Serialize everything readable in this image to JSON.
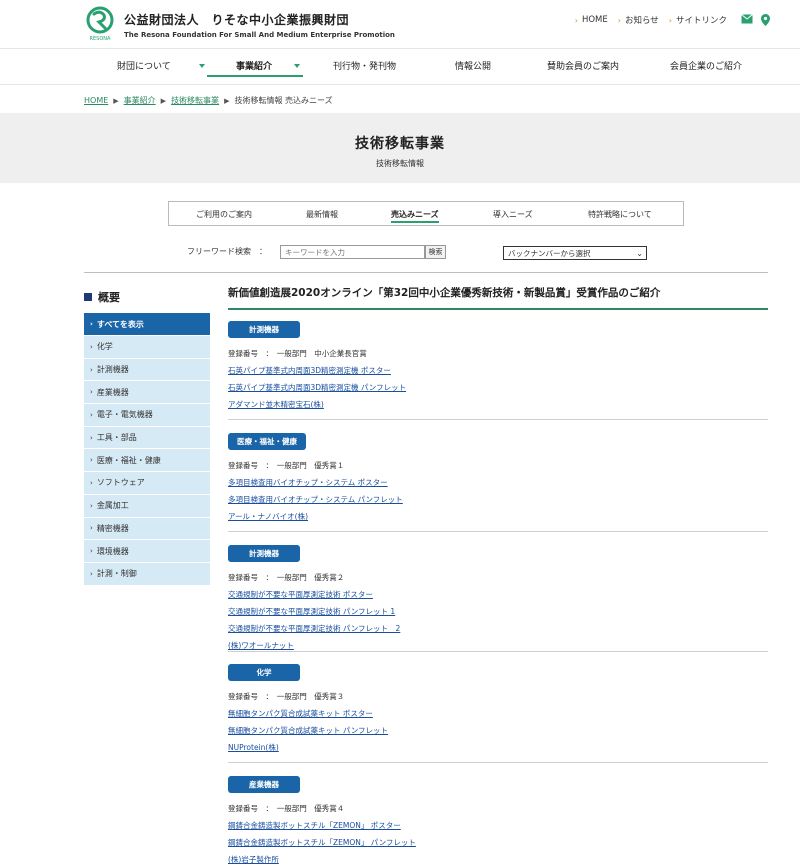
{
  "header": {
    "org_name_ja": "公益財団法人　りそな中小企業振興財団",
    "org_name_en": "The Resona Foundation For Small And Medium Enterprise Promotion",
    "logo_caption": "RESONA",
    "util_links": [
      "HOME",
      "お知らせ",
      "サイトリンク"
    ],
    "brand_color": "#2aa070"
  },
  "nav": {
    "items": [
      "財団について",
      "事業紹介",
      "刊行物・発刊物",
      "情報公開",
      "賛助会員のご案内",
      "会員企業のご紹介"
    ]
  },
  "breadcrumb": {
    "items": [
      "HOME",
      "事業紹介",
      "技術移転事業",
      "技術移転情報 売込みニーズ"
    ]
  },
  "page": {
    "title": "技術移転事業",
    "subtitle": "技術移転情報"
  },
  "tabs": [
    "ご利用のご案内",
    "最新情報",
    "売込みニーズ",
    "導入ニーズ",
    "特許戦略について"
  ],
  "search": {
    "label": "フリーワード検索　：",
    "placeholder": "キーワードを入力",
    "button": "検索",
    "backnumber": "バックナンバーから選択"
  },
  "sidebar": {
    "title": "概要",
    "items": [
      "すべてを表示",
      "化学",
      "計測機器",
      "産業機器",
      "電子・電気機器",
      "工具・部品",
      "医療・福祉・健康",
      "ソフトウェア",
      "金属加工",
      "精密機器",
      "環境機器",
      "計測・制御"
    ]
  },
  "main": {
    "heading": "新価値創造展2020オンライン「第32回中小企業優秀新技術・新製品賞」受賞作品のご紹介",
    "entries": [
      {
        "category": "計測機器",
        "reg": "登録番号　：　一般部門　中小企業長官賞",
        "links": [
          "石英パイプ基準式内周面3D精密測定機 ポスター",
          "石英パイプ基準式内周面3D精密測定機 パンフレット",
          "アダマンド並木精密宝石(株)"
        ]
      },
      {
        "category": "医療・福祉・健康",
        "reg": "登録番号　：　一般部門　優秀賞１",
        "links": [
          "多項目検査用バイオチップ・システム ポスター",
          "多項目検査用バイオチップ・システム パンフレット",
          "アール・ナノバイオ(株)"
        ]
      },
      {
        "category": "計測機器",
        "reg": "登録番号　：　一般部門　優秀賞２",
        "links": [
          "交通規制が不要な平面厚測定技術 ポスター",
          "交通規制が不要な平面厚測定技術 パンフレット 1",
          "交通規制が不要な平面厚測定技術 パンフレット　2",
          "(株)ワオールナット"
        ]
      },
      {
        "category": "化学",
        "reg": "登録番号　：　一般部門　優秀賞３",
        "links": [
          "無細胞タンパク質合成試薬キット ポスター",
          "無細胞タンパク質合成試薬キット パンフレット",
          "NUProtein(株)"
        ]
      },
      {
        "category": "産業機器",
        "reg": "登録番号　：　一般部門　優秀賞４",
        "links": [
          "鋼鋳合金鋳造製ボットスチル「ZEMON」 ポスター",
          "鋼鋳合金鋳造製ボットスチル「ZEMON」 パンフレット",
          "(株)岩子製作所"
        ]
      }
    ]
  },
  "colors": {
    "accent_green": "#2aa070",
    "side_active": "#1a64a8",
    "side_bg": "#d6eaf5",
    "badge": "#1a64a8"
  }
}
